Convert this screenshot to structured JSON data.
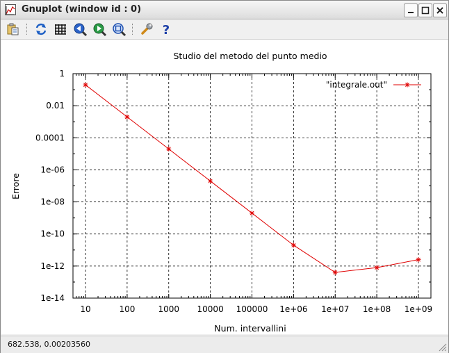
{
  "window": {
    "title": "Gnuplot (window id : 0)"
  },
  "toolbar": {
    "items": [
      {
        "name": "copy-to-clipboard-icon"
      },
      {
        "name": "replot-icon"
      },
      {
        "name": "grid-icon"
      },
      {
        "name": "zoom-previous-icon"
      },
      {
        "name": "zoom-next-icon"
      },
      {
        "name": "autoscale-icon"
      },
      {
        "name": "options-wrench-icon"
      },
      {
        "name": "help-icon"
      }
    ]
  },
  "status": {
    "coordinates": "682.538,  0.00203560"
  },
  "colors": {
    "series": "#e00000",
    "grid": "#000000"
  },
  "chart_data": {
    "type": "line",
    "title": "Studio del metodo del punto medio",
    "xlabel": "Num. intervallini",
    "ylabel": "Errore",
    "xscale": "log",
    "yscale": "log",
    "xlim": [
      5,
      2000000000
    ],
    "ylim": [
      1e-14,
      1
    ],
    "xticks": [
      {
        "value": 10,
        "label": "10"
      },
      {
        "value": 100,
        "label": "100"
      },
      {
        "value": 1000,
        "label": "1000"
      },
      {
        "value": 10000,
        "label": "10000"
      },
      {
        "value": 100000,
        "label": "100000"
      },
      {
        "value": 1000000,
        "label": "1e+06"
      },
      {
        "value": 10000000,
        "label": "1e+07"
      },
      {
        "value": 100000000,
        "label": "1e+08"
      },
      {
        "value": 1000000000,
        "label": "1e+09"
      }
    ],
    "yticks": [
      {
        "value": 1,
        "label": "1"
      },
      {
        "value": 0.01,
        "label": "0.01"
      },
      {
        "value": 0.0001,
        "label": "0.0001"
      },
      {
        "value": 1e-06,
        "label": "1e-06"
      },
      {
        "value": 1e-08,
        "label": "1e-08"
      },
      {
        "value": 1e-10,
        "label": "1e-10"
      },
      {
        "value": 1e-12,
        "label": "1e-12"
      },
      {
        "value": 1e-14,
        "label": "1e-14"
      }
    ],
    "grid": true,
    "legend_position": "top-right",
    "series": [
      {
        "name": "\"integrale.out\"",
        "marker": "star",
        "x": [
          10,
          100,
          1000,
          10000,
          100000,
          1000000,
          10000000,
          100000000,
          1000000000
        ],
        "y": [
          0.2,
          0.002,
          2e-05,
          2e-07,
          2e-09,
          2e-11,
          4e-13,
          8e-13,
          2.5e-12
        ]
      }
    ]
  }
}
